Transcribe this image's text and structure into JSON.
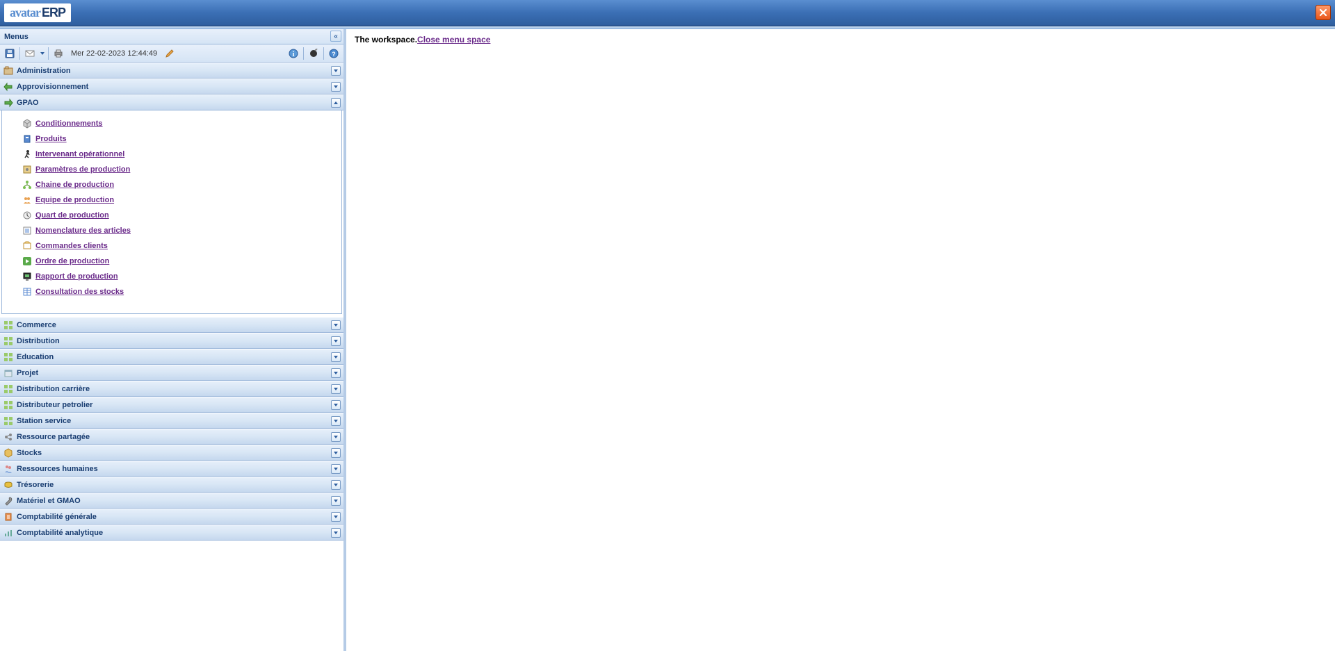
{
  "app": {
    "logo_left": "avatar",
    "logo_right": "ERP"
  },
  "sidebar": {
    "title": "Menus",
    "date": "Mer 22-02-2023 12:44:49"
  },
  "accordion": {
    "administration": "Administration",
    "approvisionnement": "Approvisionnement",
    "gpao": "GPAO",
    "commerce": "Commerce",
    "distribution": "Distribution",
    "education": "Education",
    "projet": "Projet",
    "distribution_carriere": "Distribution carrière",
    "distributeur_petrolier": "Distributeur petrolier",
    "station_service": "Station service",
    "ressource_partagee": "Ressource partagée",
    "stocks": "Stocks",
    "ressources_humaines": "Ressources humaines",
    "tresorerie": "Trésorerie",
    "materiel_gmao": "Matériel et GMAO",
    "comptabilite_generale": "Comptabilité générale",
    "comptabilite_analytique": "Comptabilité analytique"
  },
  "gpao_items": {
    "conditionnements": "Conditionnements",
    "produits": " Produits",
    "intervenant": " Intervenant opérationnel",
    "parametres": "Paramètres de production",
    "chaine": " Chaine de production",
    "equipe": " Equipe de production",
    "quart": " Quart de production",
    "nomenclature": "Nomenclature des articles",
    "commandes": " Commandes clients",
    "ordre": " Ordre de production",
    "rapport": " Rapport de production",
    "consultation": " Consultation des stocks"
  },
  "workspace": {
    "text": "The workspace.",
    "link": "Close menu space"
  }
}
